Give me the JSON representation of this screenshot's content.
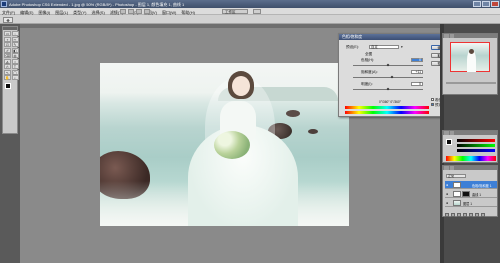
{
  "titlebar": {
    "text": "Adobe Photoshop CS6 Extended - 1.jpg @ 50% (RGB/8*) - Photoshop - 图层 1, 颜色填充 1, 曲线 1",
    "icon": "photoshop-icon"
  },
  "menus": [
    "文件(F)",
    "编辑(E)",
    "图像(I)",
    "图层(L)",
    "类型(Y)",
    "选择(S)",
    "滤镜(T)",
    "3D(D)",
    "视图(V)",
    "窗口(W)",
    "帮助(H)"
  ],
  "workspace": "工作区",
  "tools": [
    "▭",
    "◌",
    "⌖",
    "✂",
    "⊡",
    "✎",
    "✐",
    "◧",
    "⌫",
    "◍",
    "◭",
    "○",
    "✍",
    "T",
    "↖",
    "▢",
    "✋",
    "⌕"
  ],
  "dialog": {
    "title": "色相/饱和度",
    "preset_label": "预设(E):",
    "preset_value": "自定",
    "channel": "全图",
    "hue_label": "色相(H):",
    "hue_value": "0",
    "saturation_label": "饱和度(A):",
    "saturation_value": "+11",
    "lightness_label": "明度(I):",
    "lightness_value": "0",
    "readout": "0°/360° 0°/360°",
    "ok": "确定",
    "cancel": "取消",
    "btn3": "预设",
    "colorize": "着色(O)",
    "preview": "预览(P)"
  },
  "layers": {
    "blend_mode": "正常",
    "rows": [
      {
        "name": "色相/饱和度 1",
        "selected": true
      },
      {
        "name": "曲线 1",
        "selected": false
      },
      {
        "name": "图层 1",
        "selected": false
      }
    ]
  },
  "colors": {
    "accent": "#3d7fd6",
    "close": "#c0463a"
  }
}
